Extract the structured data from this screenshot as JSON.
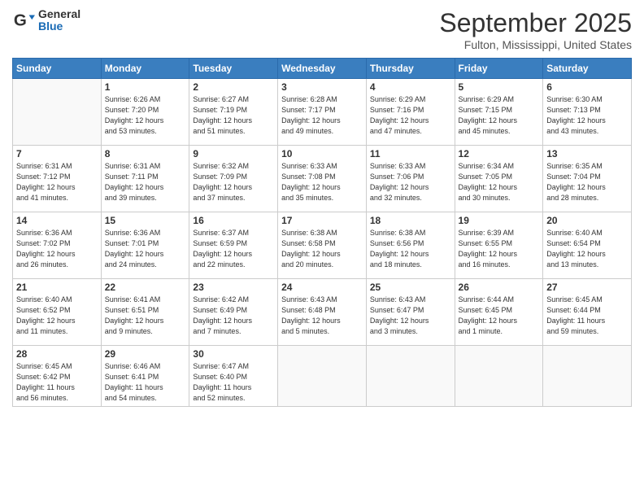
{
  "logo": {
    "general": "General",
    "blue": "Blue"
  },
  "title": "September 2025",
  "location": "Fulton, Mississippi, United States",
  "weekdays": [
    "Sunday",
    "Monday",
    "Tuesday",
    "Wednesday",
    "Thursday",
    "Friday",
    "Saturday"
  ],
  "weeks": [
    [
      {
        "day": "",
        "info": ""
      },
      {
        "day": "1",
        "info": "Sunrise: 6:26 AM\nSunset: 7:20 PM\nDaylight: 12 hours\nand 53 minutes."
      },
      {
        "day": "2",
        "info": "Sunrise: 6:27 AM\nSunset: 7:19 PM\nDaylight: 12 hours\nand 51 minutes."
      },
      {
        "day": "3",
        "info": "Sunrise: 6:28 AM\nSunset: 7:17 PM\nDaylight: 12 hours\nand 49 minutes."
      },
      {
        "day": "4",
        "info": "Sunrise: 6:29 AM\nSunset: 7:16 PM\nDaylight: 12 hours\nand 47 minutes."
      },
      {
        "day": "5",
        "info": "Sunrise: 6:29 AM\nSunset: 7:15 PM\nDaylight: 12 hours\nand 45 minutes."
      },
      {
        "day": "6",
        "info": "Sunrise: 6:30 AM\nSunset: 7:13 PM\nDaylight: 12 hours\nand 43 minutes."
      }
    ],
    [
      {
        "day": "7",
        "info": "Sunrise: 6:31 AM\nSunset: 7:12 PM\nDaylight: 12 hours\nand 41 minutes."
      },
      {
        "day": "8",
        "info": "Sunrise: 6:31 AM\nSunset: 7:11 PM\nDaylight: 12 hours\nand 39 minutes."
      },
      {
        "day": "9",
        "info": "Sunrise: 6:32 AM\nSunset: 7:09 PM\nDaylight: 12 hours\nand 37 minutes."
      },
      {
        "day": "10",
        "info": "Sunrise: 6:33 AM\nSunset: 7:08 PM\nDaylight: 12 hours\nand 35 minutes."
      },
      {
        "day": "11",
        "info": "Sunrise: 6:33 AM\nSunset: 7:06 PM\nDaylight: 12 hours\nand 32 minutes."
      },
      {
        "day": "12",
        "info": "Sunrise: 6:34 AM\nSunset: 7:05 PM\nDaylight: 12 hours\nand 30 minutes."
      },
      {
        "day": "13",
        "info": "Sunrise: 6:35 AM\nSunset: 7:04 PM\nDaylight: 12 hours\nand 28 minutes."
      }
    ],
    [
      {
        "day": "14",
        "info": "Sunrise: 6:36 AM\nSunset: 7:02 PM\nDaylight: 12 hours\nand 26 minutes."
      },
      {
        "day": "15",
        "info": "Sunrise: 6:36 AM\nSunset: 7:01 PM\nDaylight: 12 hours\nand 24 minutes."
      },
      {
        "day": "16",
        "info": "Sunrise: 6:37 AM\nSunset: 6:59 PM\nDaylight: 12 hours\nand 22 minutes."
      },
      {
        "day": "17",
        "info": "Sunrise: 6:38 AM\nSunset: 6:58 PM\nDaylight: 12 hours\nand 20 minutes."
      },
      {
        "day": "18",
        "info": "Sunrise: 6:38 AM\nSunset: 6:56 PM\nDaylight: 12 hours\nand 18 minutes."
      },
      {
        "day": "19",
        "info": "Sunrise: 6:39 AM\nSunset: 6:55 PM\nDaylight: 12 hours\nand 16 minutes."
      },
      {
        "day": "20",
        "info": "Sunrise: 6:40 AM\nSunset: 6:54 PM\nDaylight: 12 hours\nand 13 minutes."
      }
    ],
    [
      {
        "day": "21",
        "info": "Sunrise: 6:40 AM\nSunset: 6:52 PM\nDaylight: 12 hours\nand 11 minutes."
      },
      {
        "day": "22",
        "info": "Sunrise: 6:41 AM\nSunset: 6:51 PM\nDaylight: 12 hours\nand 9 minutes."
      },
      {
        "day": "23",
        "info": "Sunrise: 6:42 AM\nSunset: 6:49 PM\nDaylight: 12 hours\nand 7 minutes."
      },
      {
        "day": "24",
        "info": "Sunrise: 6:43 AM\nSunset: 6:48 PM\nDaylight: 12 hours\nand 5 minutes."
      },
      {
        "day": "25",
        "info": "Sunrise: 6:43 AM\nSunset: 6:47 PM\nDaylight: 12 hours\nand 3 minutes."
      },
      {
        "day": "26",
        "info": "Sunrise: 6:44 AM\nSunset: 6:45 PM\nDaylight: 12 hours\nand 1 minute."
      },
      {
        "day": "27",
        "info": "Sunrise: 6:45 AM\nSunset: 6:44 PM\nDaylight: 11 hours\nand 59 minutes."
      }
    ],
    [
      {
        "day": "28",
        "info": "Sunrise: 6:45 AM\nSunset: 6:42 PM\nDaylight: 11 hours\nand 56 minutes."
      },
      {
        "day": "29",
        "info": "Sunrise: 6:46 AM\nSunset: 6:41 PM\nDaylight: 11 hours\nand 54 minutes."
      },
      {
        "day": "30",
        "info": "Sunrise: 6:47 AM\nSunset: 6:40 PM\nDaylight: 11 hours\nand 52 minutes."
      },
      {
        "day": "",
        "info": ""
      },
      {
        "day": "",
        "info": ""
      },
      {
        "day": "",
        "info": ""
      },
      {
        "day": "",
        "info": ""
      }
    ]
  ]
}
